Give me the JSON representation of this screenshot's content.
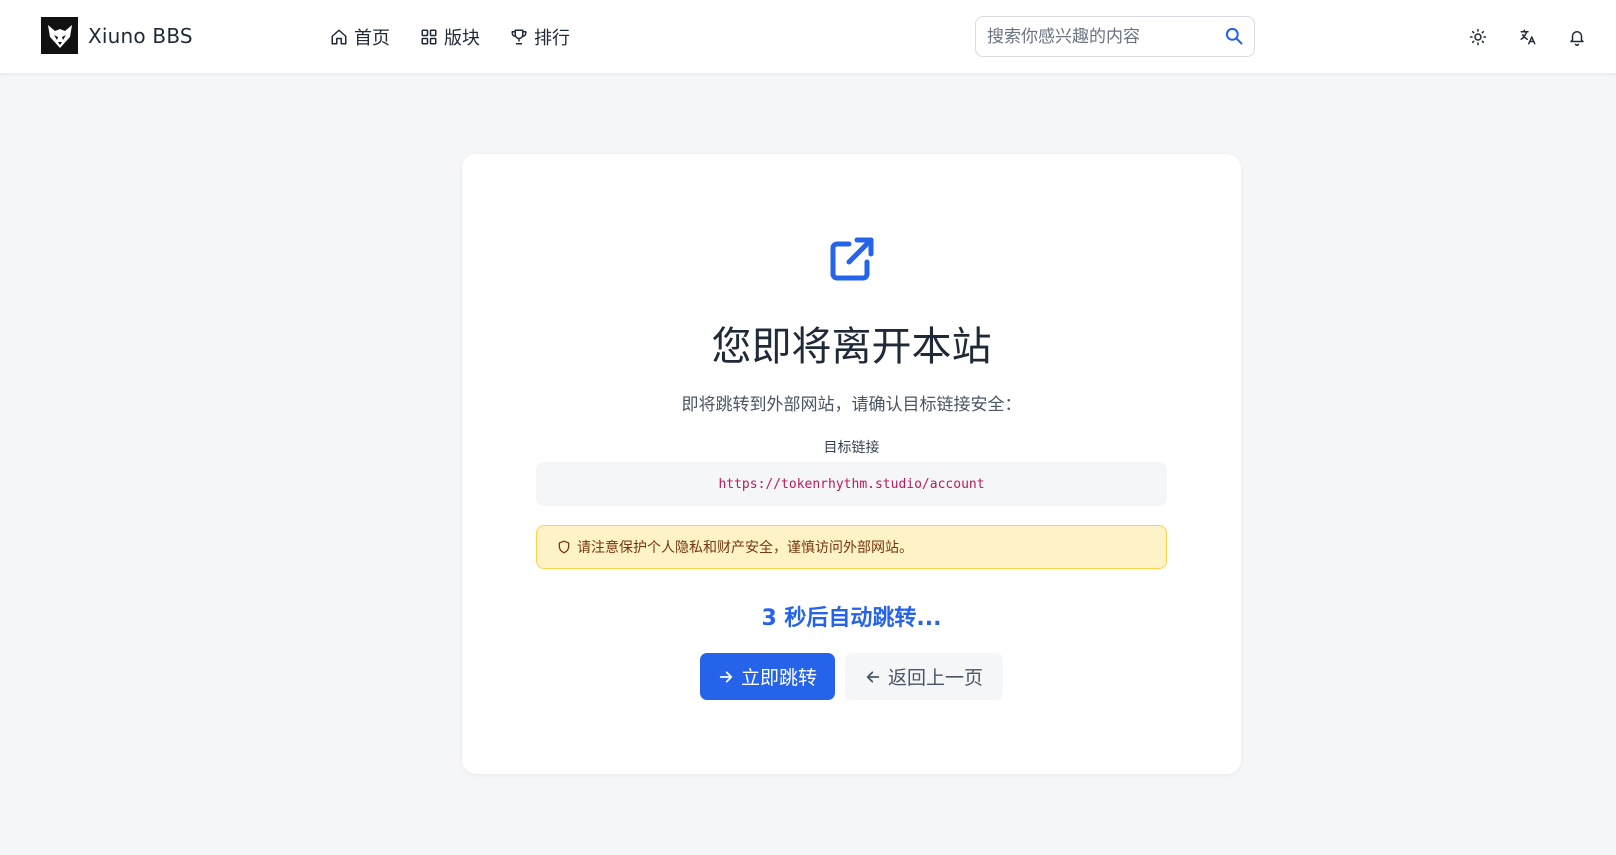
{
  "header": {
    "brand": "Xiuno BBS",
    "nav": [
      {
        "label": "首页",
        "icon": "home-icon"
      },
      {
        "label": "版块",
        "icon": "grid-icon"
      },
      {
        "label": "排行",
        "icon": "trophy-icon"
      }
    ],
    "search": {
      "placeholder": "搜索你感兴趣的内容",
      "value": ""
    },
    "tools": [
      "theme-toggle-icon",
      "translate-icon",
      "notification-bell-icon"
    ]
  },
  "redirect": {
    "icon": "external-link-icon",
    "title": "您即将离开本站",
    "subtitle": "即将跳转到外部网站，请确认目标链接安全：",
    "link_label": "目标链接",
    "url": "https://tokenrhythm.studio/account",
    "warning": "请注意保护个人隐私和财产安全，谨慎访问外部网站。",
    "countdown": "3 秒后自动跳转...",
    "primary_button": "立即跳转",
    "secondary_button": "返回上一页"
  },
  "colors": {
    "accent": "#2563eb",
    "page_bg": "#f5f6f8",
    "warning_bg": "#fef3c7",
    "warning_border": "#fcd34d",
    "url_text": "#be185d"
  }
}
